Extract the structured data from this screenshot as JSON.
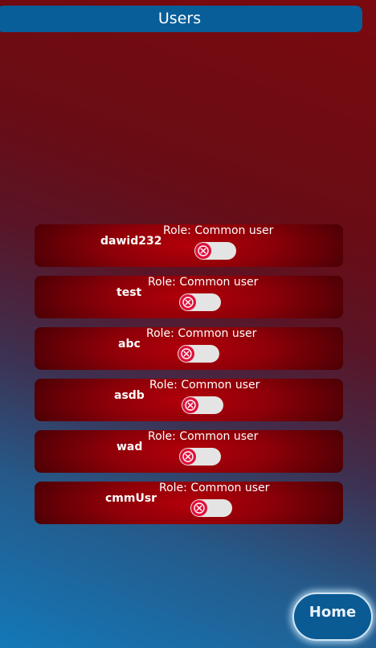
{
  "header": {
    "title": "Users"
  },
  "users": [
    {
      "name": "dawid232",
      "role": "Role: Common user",
      "enabled": false
    },
    {
      "name": "test",
      "role": "Role: Common user",
      "enabled": false
    },
    {
      "name": "abc",
      "role": "Role: Common user",
      "enabled": false
    },
    {
      "name": "asdb",
      "role": "Role: Common user",
      "enabled": false
    },
    {
      "name": "wad",
      "role": "Role: Common user",
      "enabled": false
    },
    {
      "name": "cmmUsr",
      "role": "Role: Common user",
      "enabled": false
    }
  ],
  "home_button": {
    "label": "Home"
  },
  "colors": {
    "header_bg": "#075e99",
    "row_center": "#b3000a",
    "toggle_off_knob": "#e0103a",
    "home_bg": "#0a5a93"
  }
}
